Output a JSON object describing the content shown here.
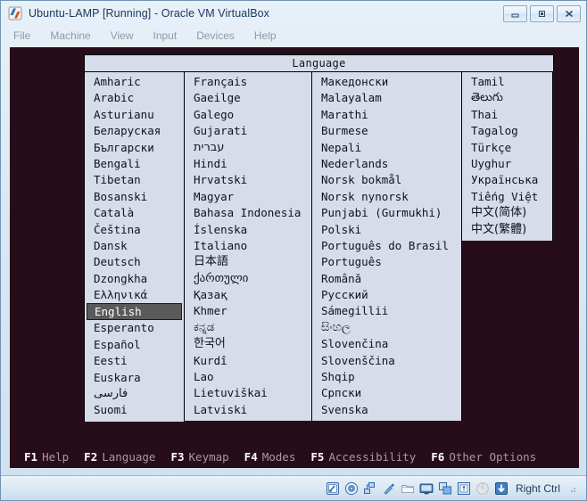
{
  "window": {
    "title": "Ubuntu-LAMP [Running] - Oracle VM VirtualBox",
    "icon": "virtualbox-icon",
    "buttons": {
      "minimize": "minimize-button",
      "restore": "restore-button",
      "close": "close-button"
    }
  },
  "menubar": {
    "items": [
      {
        "label": "File"
      },
      {
        "label": "Machine"
      },
      {
        "label": "View"
      },
      {
        "label": "Input"
      },
      {
        "label": "Devices"
      },
      {
        "label": "Help"
      }
    ]
  },
  "dialog": {
    "title": "Language",
    "selected": "English",
    "columns": [
      {
        "items": [
          "Amharic",
          "Arabic",
          "Asturianu",
          "Беларуская",
          "Български",
          "Bengali",
          "Tibetan",
          "Bosanski",
          "Català",
          "Čeština",
          "Dansk",
          "Deutsch",
          "Dzongkha",
          "Ελληνικά",
          "English",
          "Esperanto",
          "Español",
          "Eesti",
          "Euskara",
          "فارسی",
          "Suomi"
        ]
      },
      {
        "items": [
          "Français",
          "Gaeilge",
          "Galego",
          "Gujarati",
          "עברית",
          "Hindi",
          "Hrvatski",
          "Magyar",
          "Bahasa Indonesia",
          "Íslenska",
          "Italiano",
          "日本語",
          "ქართული",
          "Қазақ",
          "Khmer",
          "ಕನ್ನಡ",
          "한국어",
          "Kurdî",
          "Lao",
          "Lietuviškai",
          "Latviski"
        ]
      },
      {
        "items": [
          "Македонски",
          "Malayalam",
          "Marathi",
          "Burmese",
          "Nepali",
          "Nederlands",
          "Norsk bokmål",
          "Norsk nynorsk",
          "Punjabi (Gurmukhi)",
          "Polski",
          "Português do Brasil",
          "Português",
          "Română",
          "Русский",
          "Sámegillii",
          "සිංහල",
          "Slovenčina",
          "Slovenščina",
          "Shqip",
          "Српски",
          "Svenska"
        ]
      },
      {
        "items": [
          "Tamil",
          "తెలుగు",
          "Thai",
          "Tagalog",
          "Türkçe",
          "Uyghur",
          "Українська",
          "Tiếng Việt",
          "中文(简体)",
          "中文(繁體)"
        ]
      }
    ]
  },
  "function_keys": [
    {
      "key": "F1",
      "desc": "Help"
    },
    {
      "key": "F2",
      "desc": "Language"
    },
    {
      "key": "F3",
      "desc": "Keymap"
    },
    {
      "key": "F4",
      "desc": "Modes"
    },
    {
      "key": "F5",
      "desc": "Accessibility"
    },
    {
      "key": "F6",
      "desc": "Other Options"
    }
  ],
  "statusbar": {
    "icons": [
      "hard-disk-icon",
      "optical-disk-icon",
      "network-icon",
      "usb-icon",
      "shared-folders-icon",
      "display-icon",
      "remote-desktop-icon",
      "usb-controller-icon",
      "mouse-icon",
      "host-key-icon"
    ],
    "host_key": "Right Ctrl"
  },
  "colors": {
    "vm_background": "#270c19",
    "dialog_background": "#d7dcea",
    "selection_background": "#5a5a5a",
    "titlebar_text": "#17385c",
    "fkey_label": "#ffffff",
    "fkey_desc": "#a79aa2"
  }
}
